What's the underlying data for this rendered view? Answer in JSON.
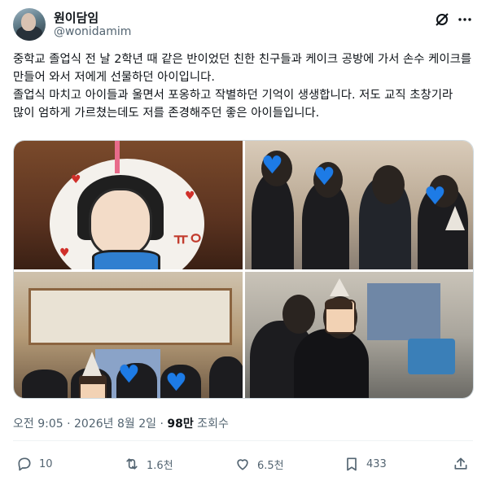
{
  "author": {
    "display_name": "원이담임",
    "handle": "@wonidamim"
  },
  "tweet": {
    "text": "중학교 졸업식 전 날 2학년 때 같은 반이었던 친한 친구들과 케이크 공방에 가서 손수 케이크를 만들어 와서 저에게 선물하던 아이입니다.\n졸업식 마치고 아이들과 울면서 포옹하고 작별하던 기억이 생생합니다. 저도 교직 초창기라 많이 엄하게 가르쳤는데도 저를 존경해주던 좋은 아이들입니다."
  },
  "media": {
    "cake_text": "ㅠㅇ"
  },
  "meta": {
    "time": "오전 9:05",
    "separator": " · ",
    "date": "2026년 8월 2일",
    "views_count": "98만",
    "views_label": " 조회수"
  },
  "actions": {
    "replies": "10",
    "retweets": "1.6천",
    "likes": "6.5천",
    "bookmarks": "433"
  },
  "icons": [
    "grok-icon",
    "more-icon",
    "reply-icon",
    "retweet-icon",
    "like-icon",
    "bookmark-icon",
    "share-icon"
  ],
  "colors": {
    "text": "#0f1419",
    "secondary": "#536471",
    "heart_emoji": "#1d7be6"
  }
}
